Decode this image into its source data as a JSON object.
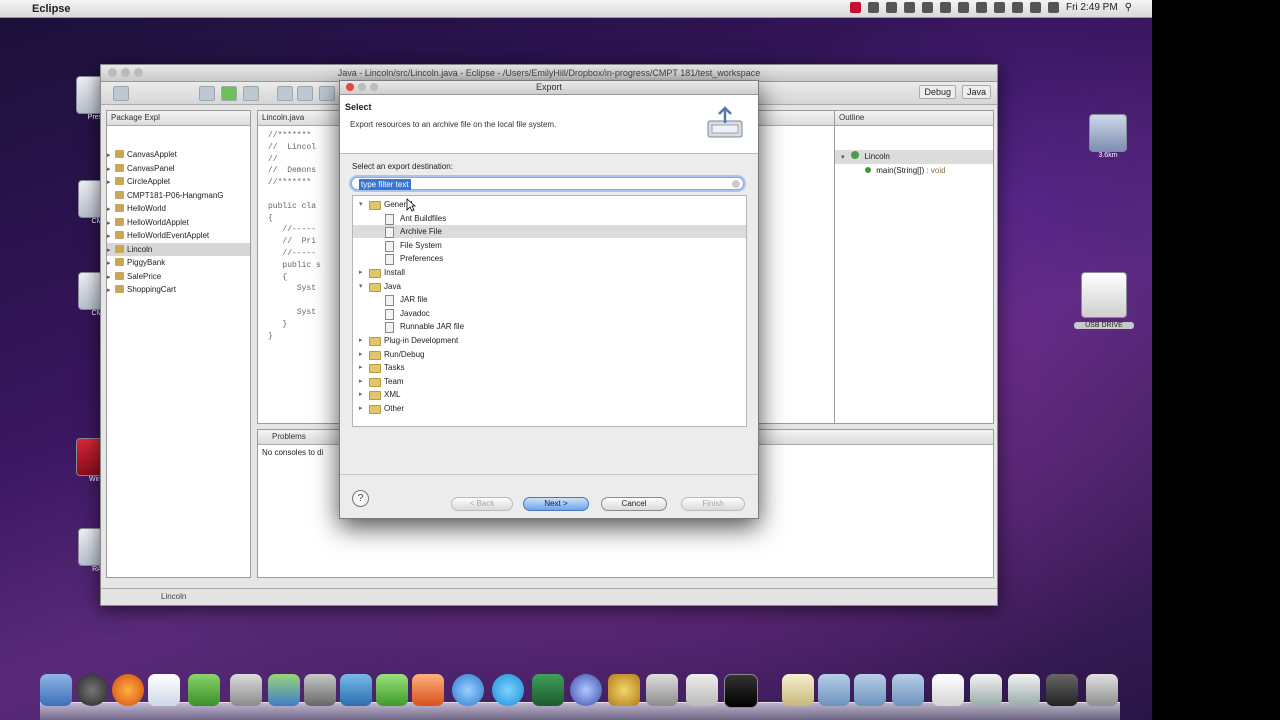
{
  "menubar": {
    "app_name": "Eclipse",
    "clock": "Fri 2:49 PM"
  },
  "desktop": {
    "icons": [
      {
        "label": "Pres"
      },
      {
        "label": "CM"
      },
      {
        "label": "CM"
      },
      {
        "label": "Win"
      },
      {
        "label": "RA"
      },
      {
        "label": "3.6km"
      },
      {
        "label": "USB DRIVE"
      }
    ]
  },
  "eclipse": {
    "title": "Java - Lincoln/src/Lincoln.java - Eclipse - /Users/EmilyHill/Dropbox/in-progress/CMPT 181/test_workspace",
    "perspectives": [
      "Debug",
      "Java"
    ],
    "package_explorer": {
      "tab": "Package Expl",
      "items": [
        {
          "label": "CanvasApplet"
        },
        {
          "label": "CanvasPanel"
        },
        {
          "label": "CircleApplet"
        },
        {
          "label": "CMPT181-P06-HangmanG"
        },
        {
          "label": "HelloWorld"
        },
        {
          "label": "HelloWorldApplet"
        },
        {
          "label": "HelloWorldEventApplet"
        },
        {
          "label": "Lincoln"
        },
        {
          "label": "PiggyBank"
        },
        {
          "label": "SalePrice"
        },
        {
          "label": "ShoppingCart"
        }
      ]
    },
    "editor": {
      "tab": "Lincoln.java",
      "lines": [
        "//*******",
        "//  Lincol",
        "//",
        "//  Demons",
        "//*******",
        "",
        "public cla",
        "{",
        "   //-----",
        "   //  Pri",
        "   //-----",
        "   public s",
        "   {",
        "      Syst",
        "",
        "      Syst",
        "   }",
        "}"
      ]
    },
    "outline": {
      "tab": "Outline",
      "class_name": "Lincoln",
      "method": "main(String[])",
      "method_type": ": void"
    },
    "console": {
      "tab": "Problems",
      "message": "No consoles to di"
    },
    "status_text": "Lincoln"
  },
  "dialog": {
    "title": "Export",
    "header_title": "Select",
    "header_desc": "Export resources to an archive file on the local file system.",
    "destination_label": "Select an export destination:",
    "filter_value": "type filter text",
    "tree": [
      {
        "label": "General",
        "kind": "folder",
        "level": 0,
        "expanded": true
      },
      {
        "label": "Ant Buildfiles",
        "kind": "file",
        "level": 1
      },
      {
        "label": "Archive File",
        "kind": "file",
        "level": 1,
        "selected": true
      },
      {
        "label": "File System",
        "kind": "file",
        "level": 1
      },
      {
        "label": "Preferences",
        "kind": "file",
        "level": 1
      },
      {
        "label": "Install",
        "kind": "folder",
        "level": 0,
        "expanded": false
      },
      {
        "label": "Java",
        "kind": "folder",
        "level": 0,
        "expanded": true
      },
      {
        "label": "JAR file",
        "kind": "file",
        "level": 1
      },
      {
        "label": "Javadoc",
        "kind": "file",
        "level": 1
      },
      {
        "label": "Runnable JAR file",
        "kind": "file",
        "level": 1
      },
      {
        "label": "Plug-in Development",
        "kind": "folder",
        "level": 0,
        "expanded": false
      },
      {
        "label": "Run/Debug",
        "kind": "folder",
        "level": 0,
        "expanded": false
      },
      {
        "label": "Tasks",
        "kind": "folder",
        "level": 0,
        "expanded": false
      },
      {
        "label": "Team",
        "kind": "folder",
        "level": 0,
        "expanded": false
      },
      {
        "label": "XML",
        "kind": "folder",
        "level": 0,
        "expanded": false
      },
      {
        "label": "Other",
        "kind": "folder",
        "level": 0,
        "expanded": false
      }
    ],
    "buttons": {
      "back": "< Back",
      "next": "Next >",
      "cancel": "Cancel",
      "finish": "Finish"
    },
    "help_glyph": "?"
  }
}
